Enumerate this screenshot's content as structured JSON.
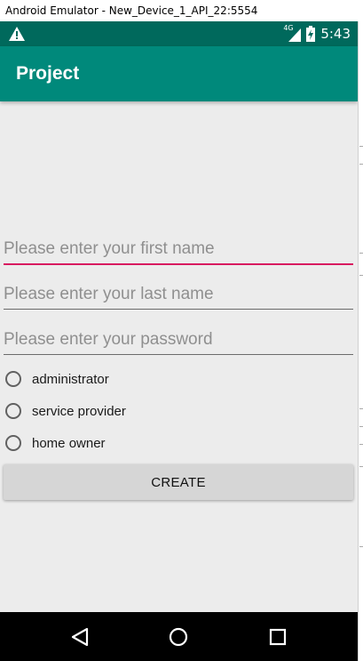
{
  "window": {
    "title": "Android Emulator - New_Device_1_API_22:5554"
  },
  "statusbar": {
    "warning_icon": "warning-icon",
    "network_label": "4G",
    "time": "5:43"
  },
  "appbar": {
    "title": "Project"
  },
  "form": {
    "first_name": {
      "placeholder": "Please enter your first name",
      "value": ""
    },
    "last_name": {
      "placeholder": "Please enter your last name",
      "value": ""
    },
    "password": {
      "placeholder": "Please enter your password",
      "value": ""
    },
    "roles": [
      {
        "label": "administrator",
        "selected": false
      },
      {
        "label": "service provider",
        "selected": false
      },
      {
        "label": "home owner",
        "selected": false
      }
    ],
    "create_label": "CREATE"
  },
  "navbar": {
    "back": "back-icon",
    "home": "home-icon",
    "recents": "recents-icon"
  },
  "colors": {
    "statusbar": "#00695c",
    "appbar": "#00897b",
    "accent": "#d81b60",
    "background": "#ececec"
  }
}
